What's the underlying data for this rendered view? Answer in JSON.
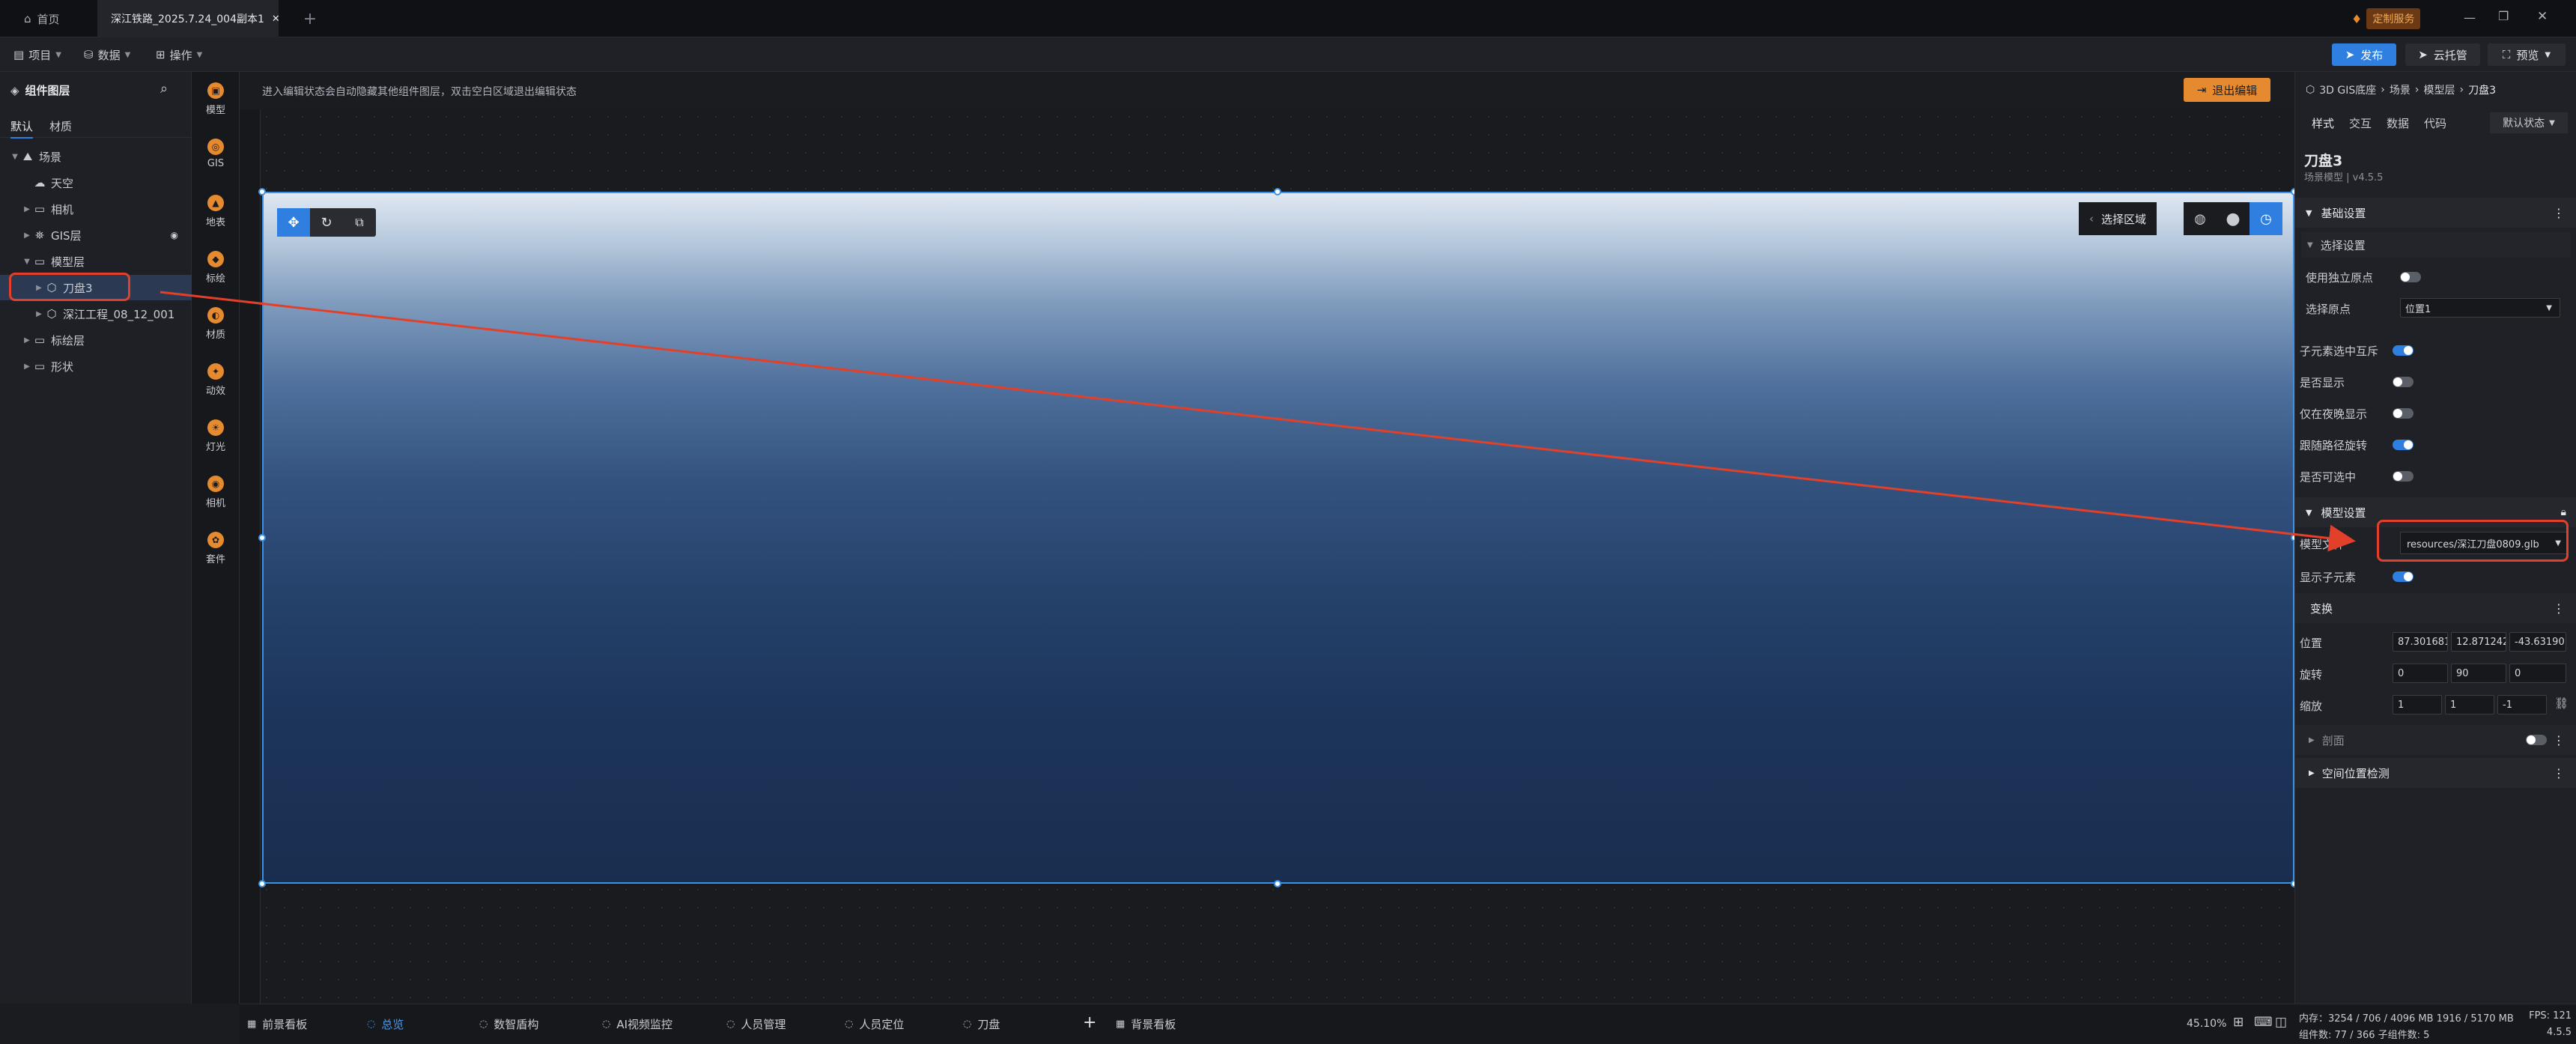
{
  "tabs": {
    "home": "首页",
    "project": "深江铁路_2025.7.24_004副本1",
    "add": "+"
  },
  "window": {
    "custom_service": "定制服务"
  },
  "toolbar": {
    "project": "项目",
    "data": "数据",
    "operate": "操作",
    "publish": "发布",
    "cloud": "云托管",
    "preview": "预览"
  },
  "left_panel": {
    "title": "组件图层",
    "tabs": [
      "默认",
      "材质"
    ],
    "tree": [
      {
        "label": "场景",
        "icon": "scene-icon",
        "level": 0,
        "expanded": true
      },
      {
        "label": "天空",
        "icon": "sky-icon",
        "level": 1
      },
      {
        "label": "相机",
        "icon": "folder-icon",
        "level": 1
      },
      {
        "label": "GIS层",
        "icon": "gis-layer-icon",
        "level": 1
      },
      {
        "label": "模型层",
        "icon": "folder-icon",
        "level": 1,
        "expanded": true
      },
      {
        "label": "刀盘3",
        "icon": "model-icon",
        "level": 2,
        "selected": true
      },
      {
        "label": "深江工程_08_12_001",
        "icon": "model-icon",
        "level": 2
      },
      {
        "label": "标绘层",
        "icon": "folder-icon",
        "level": 1
      },
      {
        "label": "形状",
        "icon": "folder-icon",
        "level": 1
      }
    ]
  },
  "icon_bar": [
    {
      "label": "模型",
      "icon": "model-icon"
    },
    {
      "label": "GIS",
      "icon": "gis-icon"
    },
    {
      "label": "地表",
      "icon": "terrain-icon"
    },
    {
      "label": "标绘",
      "icon": "marker-icon"
    },
    {
      "label": "材质",
      "icon": "material-icon"
    },
    {
      "label": "动效",
      "icon": "effect-icon"
    },
    {
      "label": "灯光",
      "icon": "light-icon"
    },
    {
      "label": "相机",
      "icon": "camera-icon"
    },
    {
      "label": "套件",
      "icon": "kit-icon"
    }
  ],
  "canvas": {
    "hint": "进入编辑状态会自动隐藏其他组件图层，双击空白区域退出编辑状态",
    "exit_edit": "退出编辑",
    "select_area": "选择区域"
  },
  "bottom_tabs": [
    {
      "label": "前景看板",
      "active": false
    },
    {
      "label": "总览",
      "active": true
    },
    {
      "label": "数智盾构",
      "active": false
    },
    {
      "label": "AI视频监控",
      "active": false
    },
    {
      "label": "人员管理",
      "active": false
    },
    {
      "label": "人员定位",
      "active": false
    },
    {
      "label": "刀盘",
      "active": false
    },
    {
      "label": "背景看板",
      "active": false
    }
  ],
  "zoom": "45.10%",
  "right_panel": {
    "breadcrumb": [
      "3D GIS底座",
      "场景",
      "模型层",
      "刀盘3"
    ],
    "tabs": [
      "样式",
      "交互",
      "数据",
      "代码"
    ],
    "state": "默认状态",
    "title": "刀盘3",
    "subtitle": "场景模型 | v4.5.5",
    "basic_section": "基础设置",
    "select_section": "选择设置",
    "use_independent_origin": "使用独立原点",
    "select_origin": "选择原点",
    "select_origin_value": "位置1",
    "child_mutex": "子元素选中互斥",
    "is_visible": "是否显示",
    "night_only": "仅在夜晚显示",
    "follow_rotation": "跟随路径旋转",
    "selectable": "是否可选中",
    "model_section": "模型设置",
    "model_file": "模型文件",
    "model_file_value": "resources/深江刀盘0809.glb",
    "show_children": "显示子元素",
    "transform_section": "变换",
    "position_label": "位置",
    "position": [
      "87.301681!",
      "12.871242!",
      "-43.63190"
    ],
    "rotation_label": "旋转",
    "rotation": [
      "0",
      "90",
      "0"
    ],
    "scale_label": "缩放",
    "scale": [
      "1",
      "1",
      "-1"
    ],
    "clip_section": "剖面",
    "space_section": "空间位置检测"
  },
  "status": {
    "memory": "内存：3254 / 706 / 4096 MB  1916 / 5170 MB",
    "components": "组件数: 77 / 366    子组件数: 5",
    "fps": "FPS: 121",
    "version": "4.5.5"
  },
  "colors": {
    "accent": "#2f7fe0",
    "orange": "#e58a2e",
    "annotation_red": "#e2402b"
  }
}
